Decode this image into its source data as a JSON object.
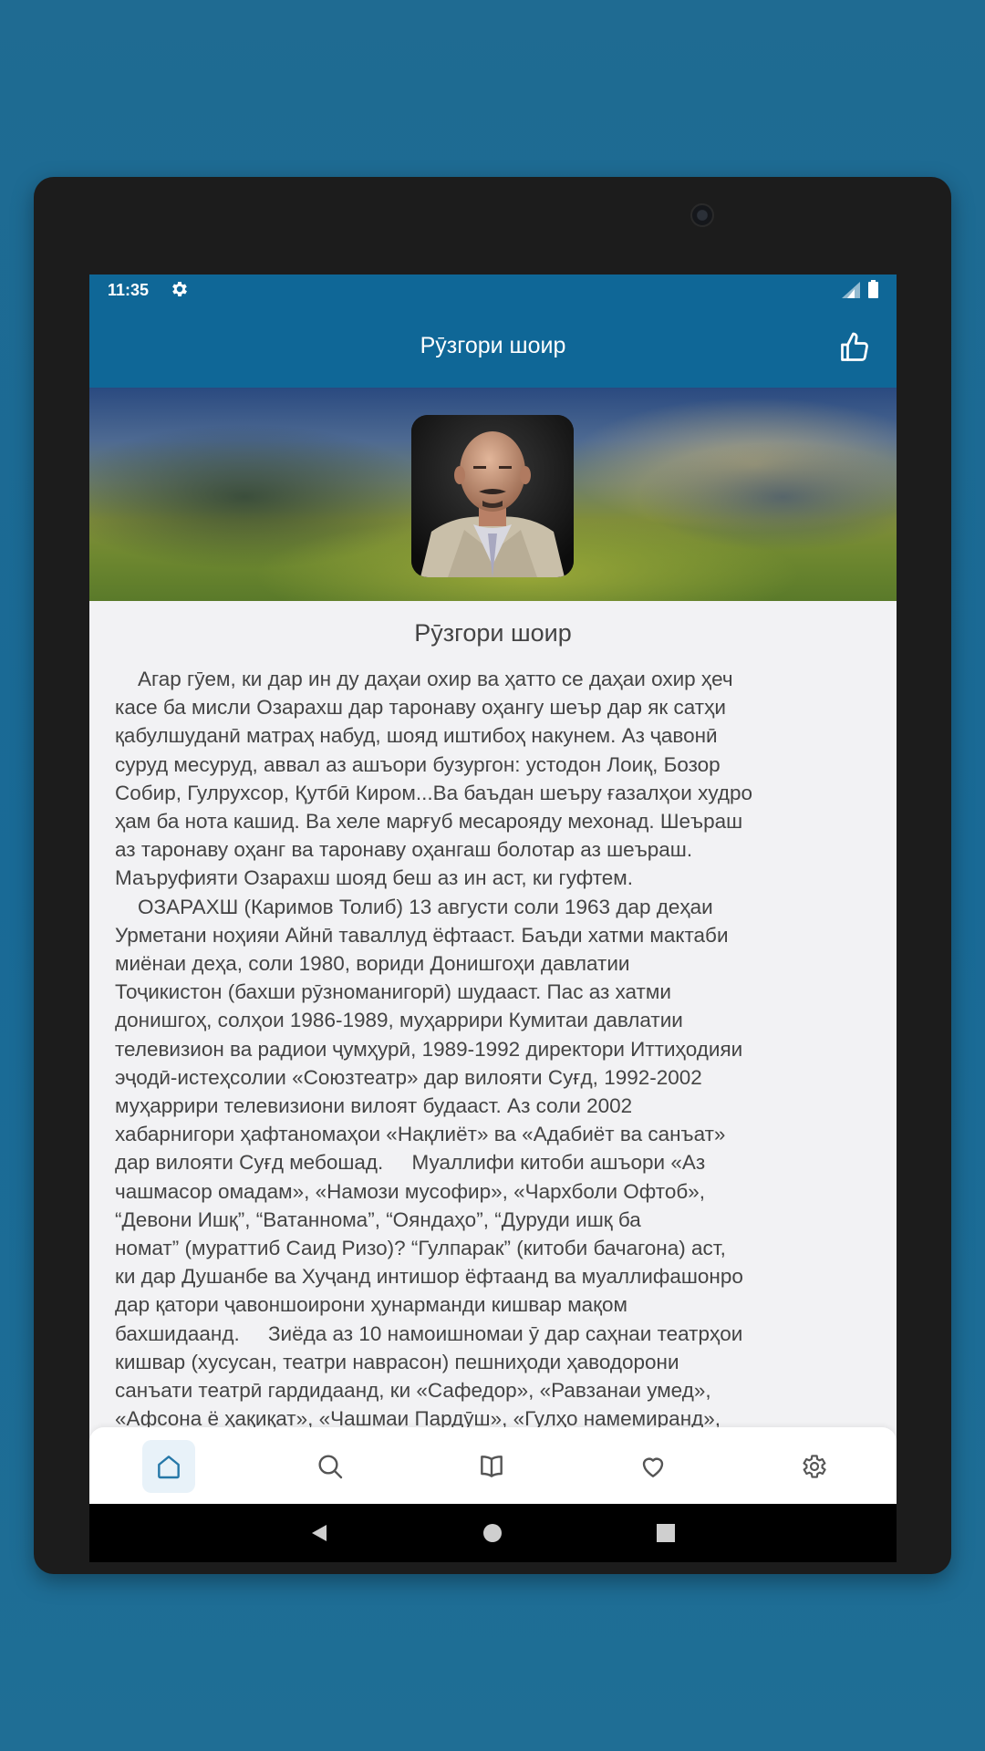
{
  "status_bar": {
    "time": "11:35"
  },
  "app_bar": {
    "title": "Рӯзгори шоир"
  },
  "content": {
    "title": "Рӯзгори шоир",
    "body": "    Агар гӯем, ки дар ин ду даҳаи охир ва ҳатто се даҳаи охир ҳеч\nкасе ба мисли Озарахш дар таронаву оҳангу шеър дар як сатҳи\nқабулшуданӣ матраҳ набуд, шояд иштибоҳ накунем. Аз ҷавонӣ\nсуруд месуруд, аввал аз ашъори бузургон: устодон Лоиқ, Бозор\nСобир, Гулрухсор, Қутбӣ Киром...Ва баъдан шеъру ғазалҳои худро\nҳам ба нота кашид. Ва хеле марғуб месарояду мехонад. Шеъраш\nаз таронаву оҳанг ва таронаву оҳангаш болотар аз шеъраш.\nМаъруфияти Озарахш шояд беш аз ин аст, ки гуфтем.\n    ОЗАРАХШ (Каримов Толиб) 13 августи соли 1963 дар деҳаи\nУрметани ноҳияи Айнӣ таваллуд ёфтааст. Баъди хатми мактаби\nмиёнаи деҳа, соли 1980, вориди Донишгоҳи давлатии\nТоҷикистон (бахши рӯзноманигорӣ) шудааст. Пас аз хатми\nдонишгоҳ, солҳои 1986-1989, муҳаррири Кумитаи давлатии\nтелевизион ва радиои ҷумҳурӣ, 1989-1992 директори Иттиҳодияи\nэҷодӣ-истеҳсолии «Союзтеатр» дар вилояти Суғд, 1992-2002\nмуҳаррири телевизиони вилоят будааст. Аз соли 2002\nхабарнигори ҳафтаномаҳои «Нақлиёт» ва «Адабиёт ва санъат»\nдар вилояти Суғд мебошад.     Муаллифи китоби ашъори «Аз\nчашмасор омадам», «Намози мусофир», «Чархболи Офтоб»,\n“Девони Ишқ”, “Ватаннома”, “Ояндаҳо”, “Дуруди ишқ ба\nномат” (мураттиб Саид Ризо)? “Гулпарак” (китоби бачагона) аст,\nки дар Душанбе ва Хуҷанд интишор ёфтаанд ва муаллифашонро\nдар қатори ҷавоншоирони ҳунарманди кишвар мақом\nбахшидаанд.     Зиёда аз 10 намоишномаи ӯ дар саҳнаи театрҳои\nкишвар (хусусан, театри наврасон) пешниҳоди ҳаводорони\nсанъати театрӣ гардидаанд, ки «Сафедор», «Равзанаи умед»,\n«Афсона ё ҳақиқат», «Чашмаи Пардӯш», «Гулҳо намемиранд»,"
  },
  "bottom_nav": {
    "items": [
      {
        "icon": "home-icon",
        "active": true
      },
      {
        "icon": "search-icon",
        "active": false
      },
      {
        "icon": "book-icon",
        "active": false
      },
      {
        "icon": "heart-icon",
        "active": false
      },
      {
        "icon": "gear-icon",
        "active": false
      }
    ]
  },
  "colors": {
    "primary": "#0f6797",
    "background": "#196a96",
    "screen_bg": "#f2f2f4",
    "text": "#444444",
    "nav_active_bg": "#e8f2f9"
  }
}
